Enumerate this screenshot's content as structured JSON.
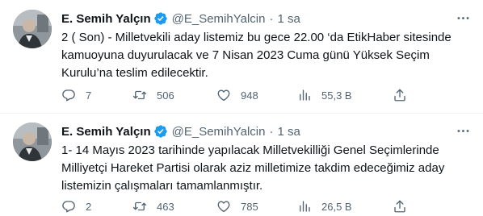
{
  "tweets": [
    {
      "author": {
        "name": "E. Semih Yalçın",
        "handle": "@E_SemihYalcin",
        "verified": true
      },
      "separator": "·",
      "time": "1 sa",
      "lines": [
        "2 ( Son) - Milletvekili aday listemiz bu gece 22.00 ‘da EtikHaber sitesinde",
        "kamuoyuna duyurulacak ve 7 Nisan 2023 Cuma günü Yüksek Seçim",
        "Kurulu’na teslim edilecektir."
      ],
      "stats": {
        "replies": "7",
        "retweets": "506",
        "likes": "948",
        "views": "55,3 B"
      }
    },
    {
      "author": {
        "name": "E. Semih Yalçın",
        "handle": "@E_SemihYalcin",
        "verified": true
      },
      "separator": "·",
      "time": "1 sa",
      "lines": [
        "1- 14 Mayıs 2023 tarihinde yapılacak Milletvekilliği Genel Seçimlerinde",
        "Milliyetçi Hareket Partisi olarak aziz milletimize takdim edeceğimiz aday",
        "listemizin çalışmaları tamamlanmıştır."
      ],
      "stats": {
        "replies": "2",
        "retweets": "463",
        "likes": "785",
        "views": "26,5 B"
      }
    }
  ],
  "icons": [
    "more-icon",
    "verified-badge-icon",
    "reply-icon",
    "retweet-icon",
    "like-icon",
    "views-icon",
    "share-icon"
  ],
  "colors": {
    "text": "#0f1419",
    "secondary": "#536471",
    "verified": "#1d9bf0",
    "divider": "#eff3f4"
  }
}
